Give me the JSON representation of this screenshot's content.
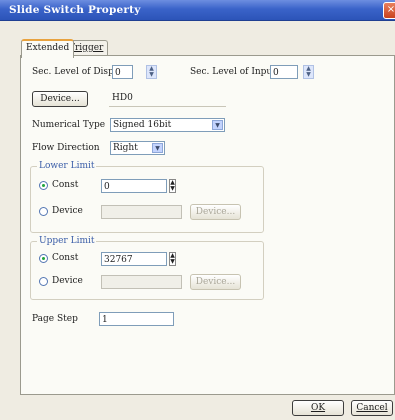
{
  "window": {
    "title": "Slide Switch Property",
    "close_glyph": "×"
  },
  "tabs": [
    {
      "label": "Extended"
    },
    {
      "label": "Trigger"
    }
  ],
  "security": {
    "display_label": "Sec. Level of Display",
    "display_value": "0",
    "input_label": "Sec. Level of Input",
    "input_value": "0"
  },
  "device": {
    "button_label": "Device...",
    "value": "HD0"
  },
  "numerical_type": {
    "label": "Numerical Type",
    "value": "Signed 16bit"
  },
  "flow_direction": {
    "label": "Flow Direction",
    "value": "Right"
  },
  "lower_limit": {
    "title": "Lower Limit",
    "const_label": "Const",
    "const_value": "0",
    "device_label": "Device",
    "device_button": "Device..."
  },
  "upper_limit": {
    "title": "Upper Limit",
    "const_label": "Const",
    "const_value": "32767",
    "device_label": "Device",
    "device_button": "Device..."
  },
  "page_step": {
    "label": "Page Step",
    "value": "1"
  },
  "footer": {
    "ok_label": "OK",
    "cancel_label": "Cancel"
  },
  "colors": {
    "title_bar": "#3a63c9",
    "tab_accent": "#e8a23e",
    "group_title": "#3b5ea8",
    "radio_selected": "#22a53c"
  },
  "icons": {
    "spin": "up-down-arrows",
    "dropdown": "chevron-down",
    "close": "x"
  }
}
